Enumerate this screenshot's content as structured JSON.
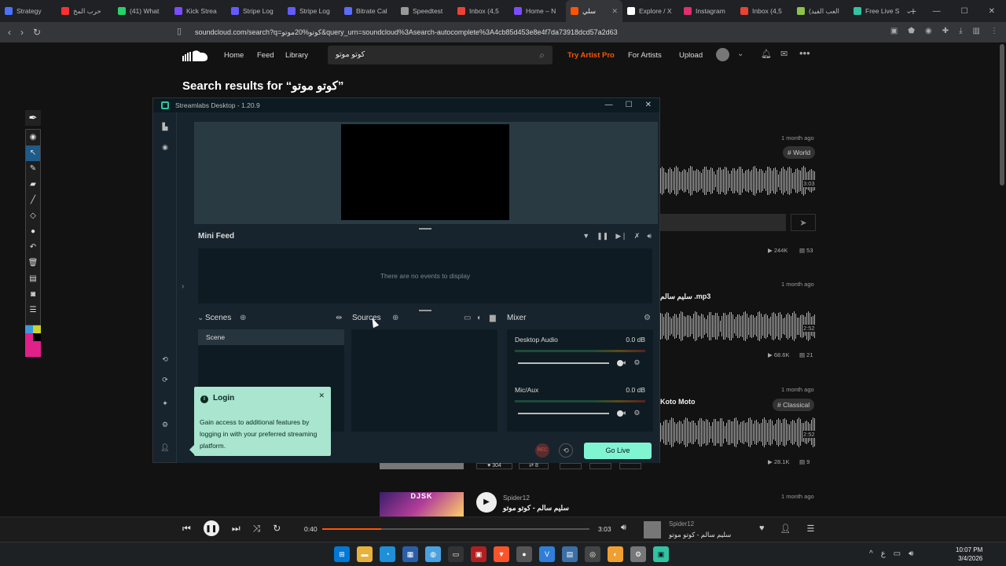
{
  "browser": {
    "tabs": [
      {
        "label": "Strategy",
        "color": "#4a72ff"
      },
      {
        "label": "حرب المخ",
        "color": "#ff3030"
      },
      {
        "label": "(41) What",
        "color": "#25d366"
      },
      {
        "label": "Kick Strea",
        "color": "#7b4dff"
      },
      {
        "label": "Stripe Log",
        "color": "#635bff"
      },
      {
        "label": "Stripe Log",
        "color": "#635bff"
      },
      {
        "label": "Bitrate Cal",
        "color": "#5b6bff"
      },
      {
        "label": "Speedtest",
        "color": "#999999"
      },
      {
        "label": "Inbox (4,5",
        "color": "#ea4335"
      },
      {
        "label": "Home – N",
        "color": "#7b4dff"
      },
      {
        "label": "سلي",
        "color": "#ff5500",
        "active": true
      },
      {
        "label": "Explore / X",
        "color": "#ffffff"
      },
      {
        "label": "Instagram",
        "color": "#e1306c"
      },
      {
        "label": "Inbox (4,5",
        "color": "#ea4335"
      },
      {
        "label": "(العب الفيد",
        "color": "#8bc34a"
      },
      {
        "label": "Free Live S",
        "color": "#31c3a2"
      }
    ],
    "new_tab": "+",
    "url": "soundcloud.com/search?q=كوتو%20موتو&query_urn=soundcloud%3Asearch-autocomplete%3A4cb85d453e8e4f7da73918dcd57a2d63"
  },
  "soundcloud": {
    "nav": {
      "home": "Home",
      "feed": "Feed",
      "library": "Library",
      "search_value": "كوتو موتو",
      "try_pro": "Try Artist Pro",
      "for_artists": "For Artists",
      "upload": "Upload"
    },
    "search_heading": "Search results for “كوتو موتو”",
    "tracks": [
      {
        "ago": "1 month ago",
        "tag": "# World",
        "duration": "3:03",
        "plays": "244K",
        "comments": "53"
      },
      {
        "ago": "1 month ago",
        "title": "سليم سالم .mp3",
        "duration": "2:52",
        "plays": "68.6K",
        "comments": "21"
      },
      {
        "ago": "1 month ago",
        "title": "Koto Moto",
        "tag": "# Classical",
        "duration": "2:52",
        "plays": "28.1K",
        "comments": "9",
        "likes": "304",
        "reposts": "8"
      },
      {
        "ago": "1 month ago",
        "artist": "Spider12",
        "title": "سليم سالم - كوتو موتو",
        "art_label": "DJSK"
      }
    ]
  },
  "streamlabs": {
    "title": "Streamlabs Desktop - 1.20.9",
    "minifeed_title": "Mini Feed",
    "empty_feed": "There are no events to display",
    "scenes_title": "Scenes",
    "scene_item": "Scene",
    "sources_title": "Sources",
    "mixer_title": "Mixer",
    "mixer": [
      {
        "name": "Desktop Audio",
        "db": "0.0 dB"
      },
      {
        "name": "Mic/Aux",
        "db": "0.0 dB"
      }
    ],
    "rec_label": "REC",
    "go_live": "Go Live",
    "login": {
      "title": "Login",
      "body": "Gain access to additional features by logging in with your preferred streaming platform."
    }
  },
  "player": {
    "current": "0:40",
    "duration": "3:03",
    "progress": 0.22,
    "artist": "Spider12",
    "title": "سليم سالم - كوتو موتو"
  },
  "taskbar": {
    "time": "10:07 PM",
    "date": "3/4/2026",
    "lang": "ع"
  }
}
